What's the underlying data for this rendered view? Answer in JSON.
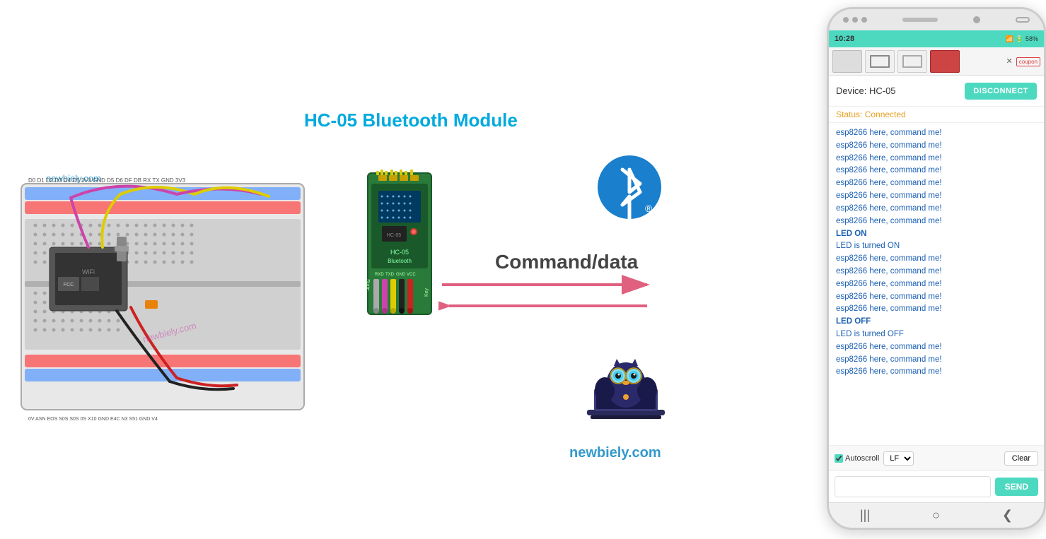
{
  "diagram": {
    "title": "HC-05 Bluetooth Module",
    "command_label": "Command/data",
    "breadboard_watermark": "newbiely.com",
    "newbiely_url": "newbiely.com"
  },
  "phone": {
    "status_bar": {
      "time": "10:28",
      "battery": "58%",
      "signal_icon": "📶"
    },
    "ad": {
      "close_label": "✕",
      "coupon_label": "coupon"
    },
    "device_header": {
      "device_label": "Device: HC-05",
      "disconnect_label": "DISCONNECT"
    },
    "status": {
      "text": "Status: Connected"
    },
    "serial_lines": [
      {
        "text": "esp8266 here, command me!",
        "type": "command"
      },
      {
        "text": "esp8266 here, command me!",
        "type": "command"
      },
      {
        "text": "esp8266 here, command me!",
        "type": "command"
      },
      {
        "text": "esp8266 here, command me!",
        "type": "command"
      },
      {
        "text": "esp8266 here, command me!",
        "type": "command"
      },
      {
        "text": "esp8266 here, command me!",
        "type": "command"
      },
      {
        "text": "esp8266 here, command me!",
        "type": "command"
      },
      {
        "text": "esp8266 here, command me!",
        "type": "command"
      },
      {
        "text": "LED ON",
        "type": "highlight-on"
      },
      {
        "text": "LED is turned ON",
        "type": "response"
      },
      {
        "text": "esp8266 here, command me!",
        "type": "command"
      },
      {
        "text": "esp8266 here, command me!",
        "type": "command"
      },
      {
        "text": "esp8266 here, command me!",
        "type": "command"
      },
      {
        "text": "esp8266 here, command me!",
        "type": "command"
      },
      {
        "text": "esp8266 here, command me!",
        "type": "command"
      },
      {
        "text": "LED OFF",
        "type": "highlight-off"
      },
      {
        "text": "LED is turned OFF",
        "type": "response"
      },
      {
        "text": "esp8266 here, command me!",
        "type": "command"
      },
      {
        "text": "esp8266 here, command me!",
        "type": "command"
      },
      {
        "text": "esp8266 here, command me!",
        "type": "command"
      }
    ],
    "controls": {
      "autoscroll_label": "Autoscroll",
      "lf_option": "LF",
      "clear_label": "Clear"
    },
    "send": {
      "placeholder": "",
      "send_label": "SEND"
    },
    "bottom_nav": {
      "back": "❮",
      "home": "○",
      "recent": "|||"
    }
  }
}
